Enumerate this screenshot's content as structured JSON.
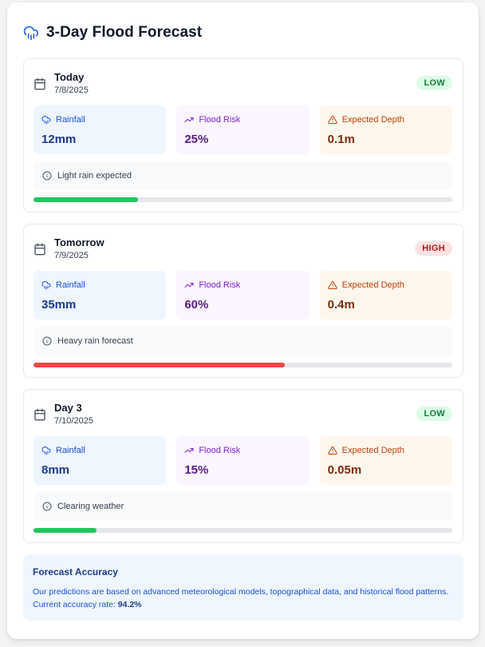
{
  "header": {
    "title": "3-Day Flood Forecast",
    "icon": "cloud-rain-icon",
    "accent": "#2563eb"
  },
  "labels": {
    "rainfall": "Rainfall",
    "flood_risk": "Flood Risk",
    "expected_depth": "Expected Depth"
  },
  "days": [
    {
      "name": "Today",
      "date": "7/8/2025",
      "badge": "LOW",
      "level": "low",
      "rainfall": "12mm",
      "flood_risk": "25%",
      "expected_depth": "0.1m",
      "note": "Light rain expected",
      "risk_fraction": 0.25,
      "bar_color": "#22c55e"
    },
    {
      "name": "Tomorrow",
      "date": "7/9/2025",
      "badge": "HIGH",
      "level": "high",
      "rainfall": "35mm",
      "flood_risk": "60%",
      "expected_depth": "0.4m",
      "note": "Heavy rain forecast",
      "risk_fraction": 0.6,
      "bar_color": "#ef4444"
    },
    {
      "name": "Day 3",
      "date": "7/10/2025",
      "badge": "LOW",
      "level": "low",
      "rainfall": "8mm",
      "flood_risk": "15%",
      "expected_depth": "0.05m",
      "note": "Clearing weather",
      "risk_fraction": 0.15,
      "bar_color": "#22c55e"
    }
  ],
  "accuracy": {
    "title": "Forecast Accuracy",
    "text": "Our predictions are based on advanced meteorological models, topographical data, and historical flood patterns. Current accuracy rate:",
    "rate": "94.2%"
  }
}
